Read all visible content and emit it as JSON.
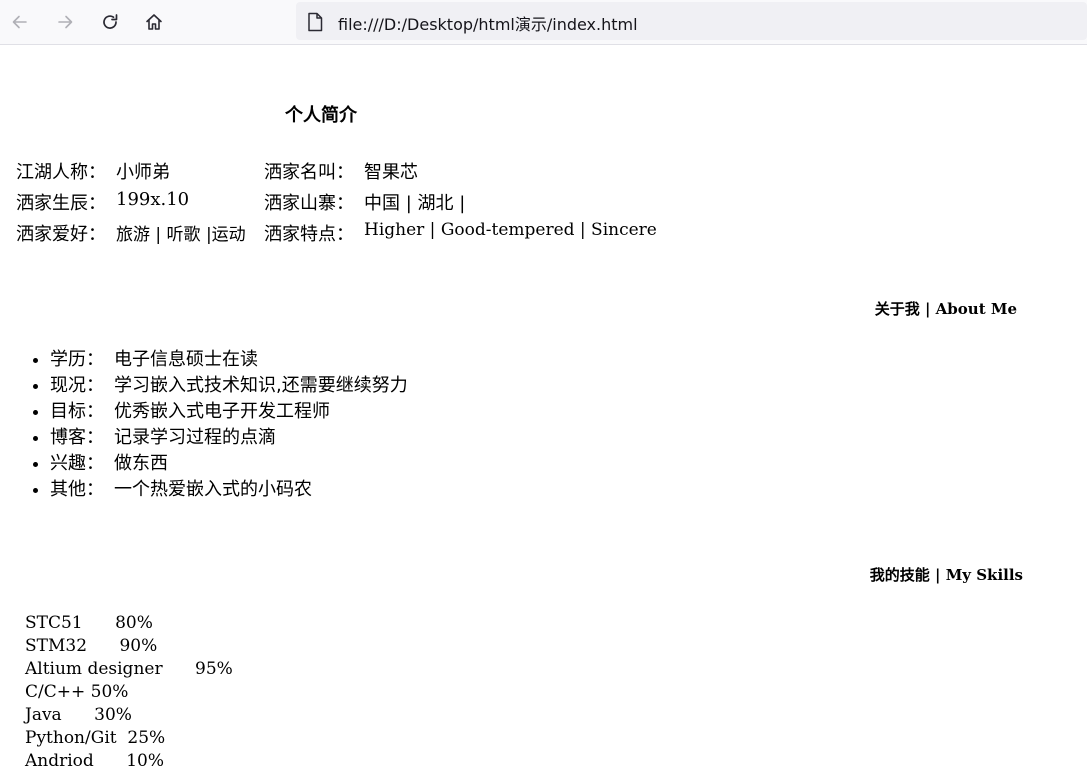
{
  "browser": {
    "url": "file:///D:/Desktop/html演示/index.html",
    "icons": [
      "back-icon",
      "forward-icon",
      "reload-icon",
      "home-icon",
      "file-icon"
    ]
  },
  "profile": {
    "title": "个人简介",
    "rows": [
      {
        "left": {
          "label": "江湖人称：",
          "value": "小师弟"
        },
        "right": {
          "label": "洒家名叫：",
          "value": "智果芯"
        }
      },
      {
        "left": {
          "label": "洒家生辰：",
          "value": "199x.10"
        },
        "right": {
          "label": "洒家山寨：",
          "value": "中国 | 湖北 |"
        }
      },
      {
        "left": {
          "label": "洒家爱好：",
          "value": "旅游 | 听歌 |运动"
        },
        "right": {
          "label": "洒家特点：",
          "value": "Higher | Good-tempered | Sincere"
        }
      }
    ]
  },
  "about": {
    "title_cn": "关于我",
    "title_sep": " | ",
    "title_en": "About Me",
    "items": [
      {
        "key": "学历：",
        "value": "电子信息硕士在读"
      },
      {
        "key": "现况：",
        "value": "学习嵌入式技术知识,还需要继续努力"
      },
      {
        "key": "目标：",
        "value": "优秀嵌入式电子开发工程师"
      },
      {
        "key": "博客：",
        "value": "记录学习过程的点滴"
      },
      {
        "key": "兴趣：",
        "value": "做东西"
      },
      {
        "key": "其他：",
        "value": "一个热爱嵌入式的小码农"
      }
    ]
  },
  "skills": {
    "title_cn": "我的技能",
    "title_sep": " | ",
    "title_en": "My Skills",
    "items": [
      {
        "name": "STC51",
        "gap": "      ",
        "percent": "80%"
      },
      {
        "name": "STM32",
        "gap": "      ",
        "percent": "90%"
      },
      {
        "name": "Altium designer",
        "gap": "      ",
        "percent": "95%"
      },
      {
        "name": "C/C++",
        "gap": " ",
        "percent": "50%"
      },
      {
        "name": "Java",
        "gap": "      ",
        "percent": "30%"
      },
      {
        "name": "Python/Git",
        "gap": "  ",
        "percent": "25%"
      },
      {
        "name": "Andriod",
        "gap": "      ",
        "percent": "10%"
      }
    ]
  }
}
